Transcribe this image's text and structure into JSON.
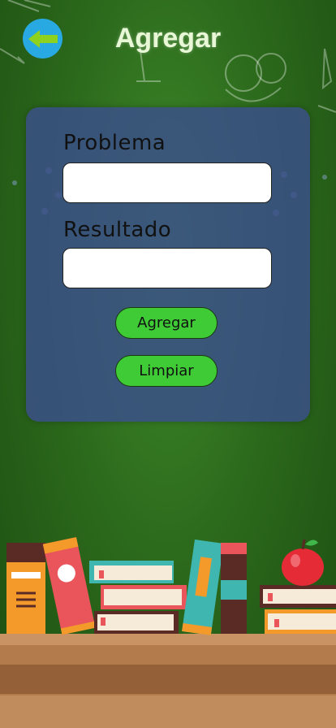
{
  "header": {
    "title": "Agregar",
    "back_icon": "arrow-left-icon"
  },
  "form": {
    "problem_label": "Problema",
    "problem_value": "",
    "result_label": "Resultado",
    "result_value": "",
    "add_button": "Agregar",
    "clear_button": "Limpiar"
  },
  "colors": {
    "background": "#2c6a1c",
    "panel": "#3a4e8c",
    "button": "#3fcb36",
    "back_button": "#29a9e1",
    "arrow": "#8ed11f"
  }
}
